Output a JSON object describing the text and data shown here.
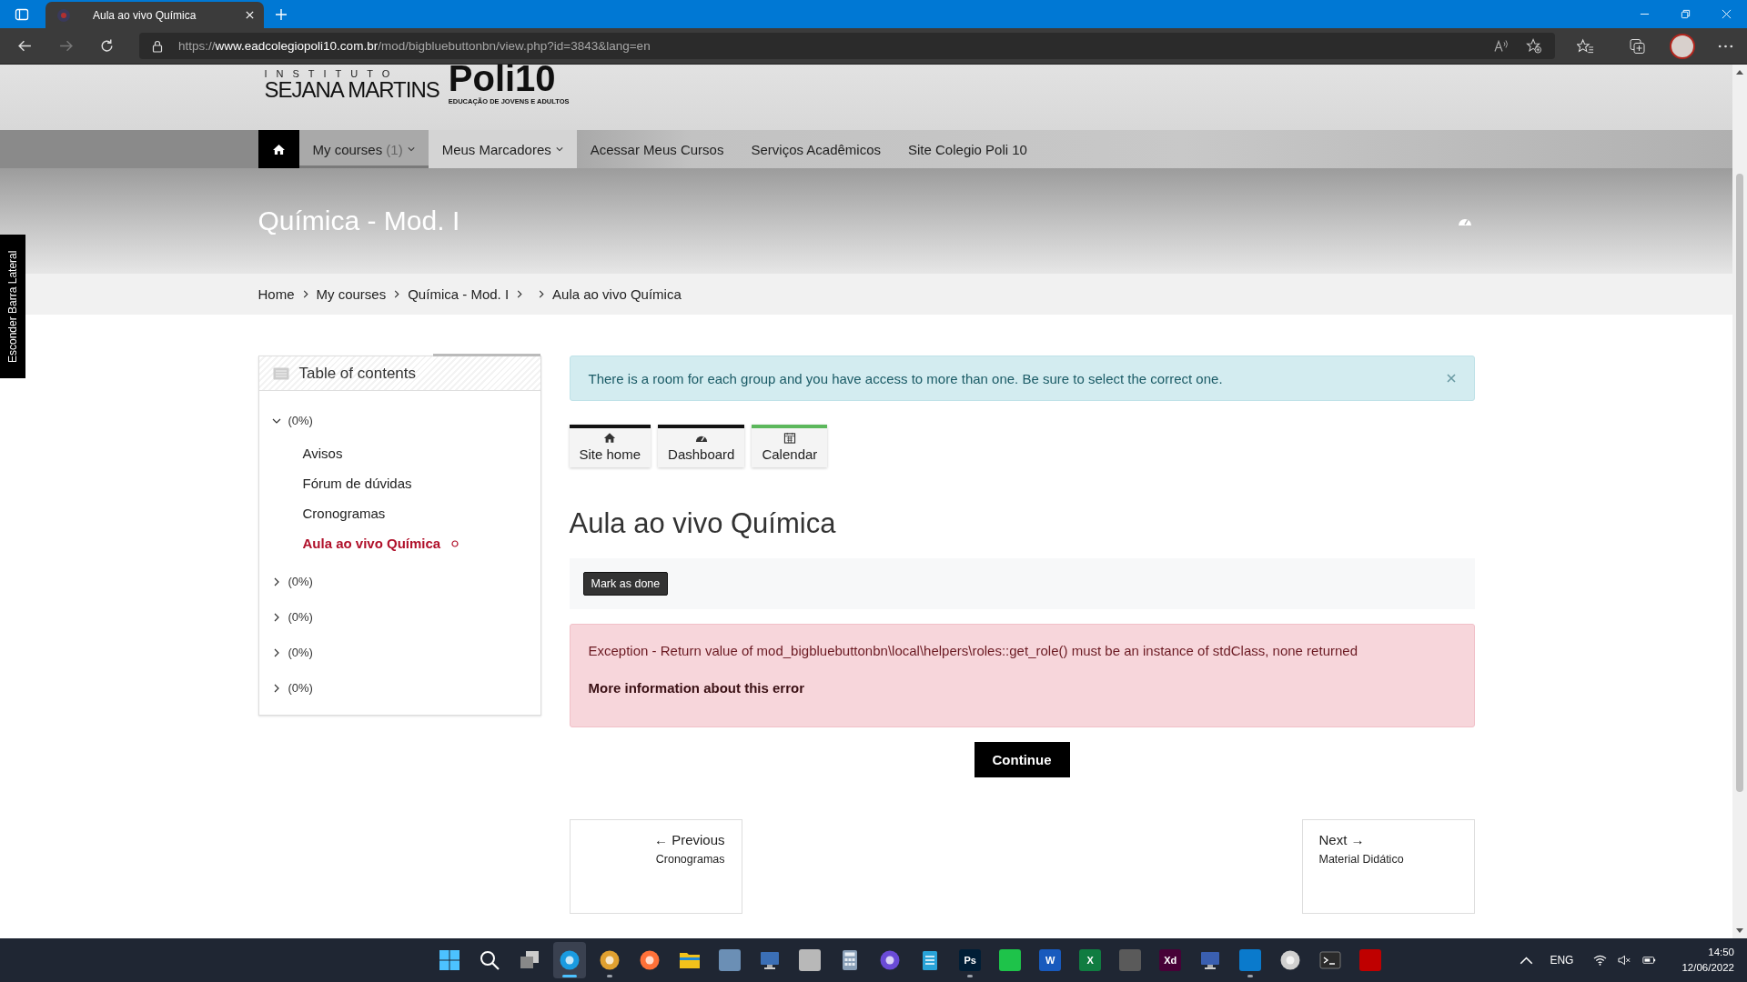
{
  "browser": {
    "tab_title": "Aula ao vivo Química",
    "url": "https://**www.eadcolegiopoli10.com.br**/mod/bigbluebuttonbn/view.php?id=3843&lang=en",
    "forward_disabled": true
  },
  "site_header": {
    "logo_top": "INSTITUTO",
    "logo_name": "SEJANA MARTINS",
    "brand": "Poli10",
    "brand_tagline": "EDUCAÇÃO DE JOVENS E ADULTOS"
  },
  "nav": {
    "items": [
      {
        "label": "My courses",
        "count": "(1)",
        "has_menu": true,
        "selected": true,
        "hovered": false
      },
      {
        "label": "Meus Marcadores",
        "has_menu": true,
        "selected": false,
        "hovered": true
      },
      {
        "label": "Acessar Meus Cursos",
        "has_menu": false,
        "selected": false,
        "hovered": false
      },
      {
        "label": "Serviços Acadêmicos",
        "has_menu": false,
        "selected": false,
        "hovered": false
      },
      {
        "label": "Site Colegio Poli 10",
        "has_menu": false,
        "selected": false,
        "hovered": false
      }
    ]
  },
  "banner": {
    "title": "Química - Mod. I"
  },
  "breadcrumb": [
    {
      "kind": "link",
      "label": "Home"
    },
    {
      "kind": "link",
      "label": "My courses"
    },
    {
      "kind": "link",
      "label": "Química - Mod. I"
    },
    {
      "kind": "blank"
    },
    {
      "kind": "current",
      "label": "Aula ao vivo Química"
    }
  ],
  "side_tab": {
    "label": "Esconder Barra Lateral"
  },
  "toc": {
    "title": "Table of contents",
    "sections": [
      {
        "label": "(0%)",
        "expanded": true,
        "children": [
          {
            "label": "Avisos",
            "selected": false,
            "completion_mark": false
          },
          {
            "label": "Fórum de dúvidas",
            "selected": false,
            "completion_mark": false
          },
          {
            "label": "Cronogramas",
            "selected": false,
            "completion_mark": false
          },
          {
            "label": "Aula ao vivo Química",
            "selected": true,
            "completion_mark": true
          }
        ]
      },
      {
        "label": "(0%)",
        "expanded": false
      },
      {
        "label": "(0%)",
        "expanded": false
      },
      {
        "label": "(0%)",
        "expanded": false
      },
      {
        "label": "(0%)",
        "expanded": false
      }
    ]
  },
  "alert": {
    "text": "There is a room for each group and you have access to more than one. Be sure to select the correct one.",
    "dismissible": true
  },
  "quick_links": [
    {
      "kind": "home",
      "label": "Site home",
      "color": "#111111"
    },
    {
      "kind": "dashboard",
      "label": "Dashboard",
      "color": "#111111"
    },
    {
      "kind": "calendar",
      "label": "Calendar",
      "color": "#5cb85c"
    }
  ],
  "page_title": "Aula ao vivo Química",
  "completion": {
    "button": "Mark as done"
  },
  "error": {
    "message": "Exception - Return value of mod_bigbluebuttonbn\\local\\helpers\\roles::get_role() must be an instance of stdClass, none returned",
    "more_link": "More information about this error"
  },
  "continue_button": "Continue",
  "pager": {
    "previous": {
      "label": "← Previous",
      "target": "Cronogramas"
    },
    "next": {
      "label": "Next →",
      "target": "Material Didático"
    }
  },
  "taskbar": {
    "apps": [
      {
        "kind": "start",
        "running": false,
        "selected": false
      },
      {
        "kind": "search",
        "running": false,
        "selected": false
      },
      {
        "kind": "taskview",
        "running": false,
        "selected": false
      },
      {
        "kind": "round",
        "color": "#1a9be0",
        "running": true,
        "selected": true
      },
      {
        "kind": "round",
        "color": "#e0a030",
        "running": true,
        "selected": false
      },
      {
        "kind": "round",
        "color": "#ff7139",
        "running": false,
        "selected": false
      },
      {
        "kind": "folder",
        "color": "#f2c21b",
        "running": false,
        "selected": false
      },
      {
        "kind": "tile",
        "color": "#6b8fb5",
        "running": false,
        "selected": false
      },
      {
        "kind": "monitor",
        "color": "#3b6fb6",
        "running": false,
        "selected": false
      },
      {
        "kind": "tile",
        "color": "#b8b8b8",
        "running": false,
        "selected": false
      },
      {
        "kind": "calculator",
        "color": "#8aa0b8",
        "running": false,
        "selected": false
      },
      {
        "kind": "round",
        "color": "#6a4bd6",
        "running": false,
        "selected": false
      },
      {
        "kind": "notepad",
        "color": "#29a3d8",
        "running": false,
        "selected": false
      },
      {
        "kind": "tile",
        "color": "#001e36",
        "label": "Ps",
        "running": true,
        "selected": false
      },
      {
        "kind": "tile",
        "color": "#1ec34a",
        "running": false,
        "selected": false
      },
      {
        "kind": "tile",
        "color": "#185abd",
        "label": "W",
        "running": false,
        "selected": false
      },
      {
        "kind": "tile",
        "color": "#107c41",
        "label": "X",
        "running": false,
        "selected": false
      },
      {
        "kind": "tile",
        "color": "#5a5a5a",
        "running": false,
        "selected": false
      },
      {
        "kind": "tile",
        "color": "#470137",
        "label": "Xd",
        "running": false,
        "selected": false
      },
      {
        "kind": "monitor",
        "color": "#3a5fb0",
        "running": false,
        "selected": false
      },
      {
        "kind": "tile",
        "color": "#0a7acc",
        "running": true,
        "selected": false
      },
      {
        "kind": "round",
        "color": "#d0d0d0",
        "running": false,
        "selected": false
      },
      {
        "kind": "terminal",
        "color": "#2b2b2b",
        "running": false,
        "selected": false
      },
      {
        "kind": "tile",
        "color": "#bf0000",
        "running": false,
        "selected": false
      }
    ],
    "language": "ENG",
    "time": "14:50",
    "date": "12/06/2022"
  }
}
